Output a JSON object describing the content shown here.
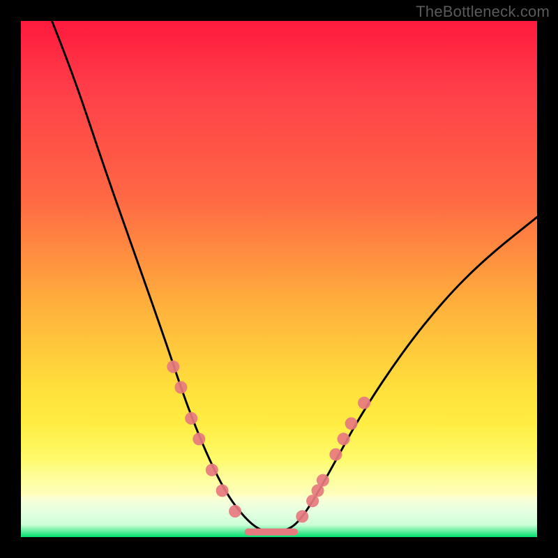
{
  "watermark": {
    "text": "TheBottleneck.com"
  },
  "colors": {
    "frame": "#000000",
    "curve": "#000000",
    "marker_fill": "#e77a7f",
    "marker_stroke": "#c95b60",
    "gradient_top": "#ff1a3d",
    "gradient_mid": "#ffe23c",
    "gradient_bottom": "#00e070"
  },
  "chart_data": {
    "type": "line",
    "title": "",
    "xlabel": "",
    "ylabel": "",
    "xlim": [
      0,
      100
    ],
    "ylim": [
      0,
      100
    ],
    "grid": false,
    "legend": false,
    "curve": [
      {
        "x": 6,
        "y": 100
      },
      {
        "x": 10,
        "y": 90
      },
      {
        "x": 16,
        "y": 72
      },
      {
        "x": 22,
        "y": 55
      },
      {
        "x": 28,
        "y": 38
      },
      {
        "x": 32,
        "y": 26
      },
      {
        "x": 36,
        "y": 16
      },
      {
        "x": 40,
        "y": 8
      },
      {
        "x": 44,
        "y": 3
      },
      {
        "x": 47,
        "y": 1
      },
      {
        "x": 50,
        "y": 1
      },
      {
        "x": 53,
        "y": 2
      },
      {
        "x": 56,
        "y": 6
      },
      {
        "x": 60,
        "y": 13
      },
      {
        "x": 66,
        "y": 24
      },
      {
        "x": 74,
        "y": 36
      },
      {
        "x": 82,
        "y": 46
      },
      {
        "x": 90,
        "y": 54
      },
      {
        "x": 100,
        "y": 62
      }
    ],
    "markers_left": [
      {
        "x": 29.5,
        "y": 33
      },
      {
        "x": 31.0,
        "y": 29
      },
      {
        "x": 33.0,
        "y": 23
      },
      {
        "x": 34.5,
        "y": 19
      },
      {
        "x": 37.0,
        "y": 13
      },
      {
        "x": 39.0,
        "y": 9
      },
      {
        "x": 41.5,
        "y": 5
      }
    ],
    "markers_right": [
      {
        "x": 54.5,
        "y": 4
      },
      {
        "x": 56.5,
        "y": 7
      },
      {
        "x": 57.5,
        "y": 9
      },
      {
        "x": 58.5,
        "y": 11
      },
      {
        "x": 61.0,
        "y": 16
      },
      {
        "x": 62.5,
        "y": 19
      },
      {
        "x": 64.0,
        "y": 22
      },
      {
        "x": 66.5,
        "y": 26
      }
    ],
    "trough_bar": {
      "x_start": 44,
      "x_end": 53,
      "y": 1,
      "thickness_px": 10
    }
  }
}
